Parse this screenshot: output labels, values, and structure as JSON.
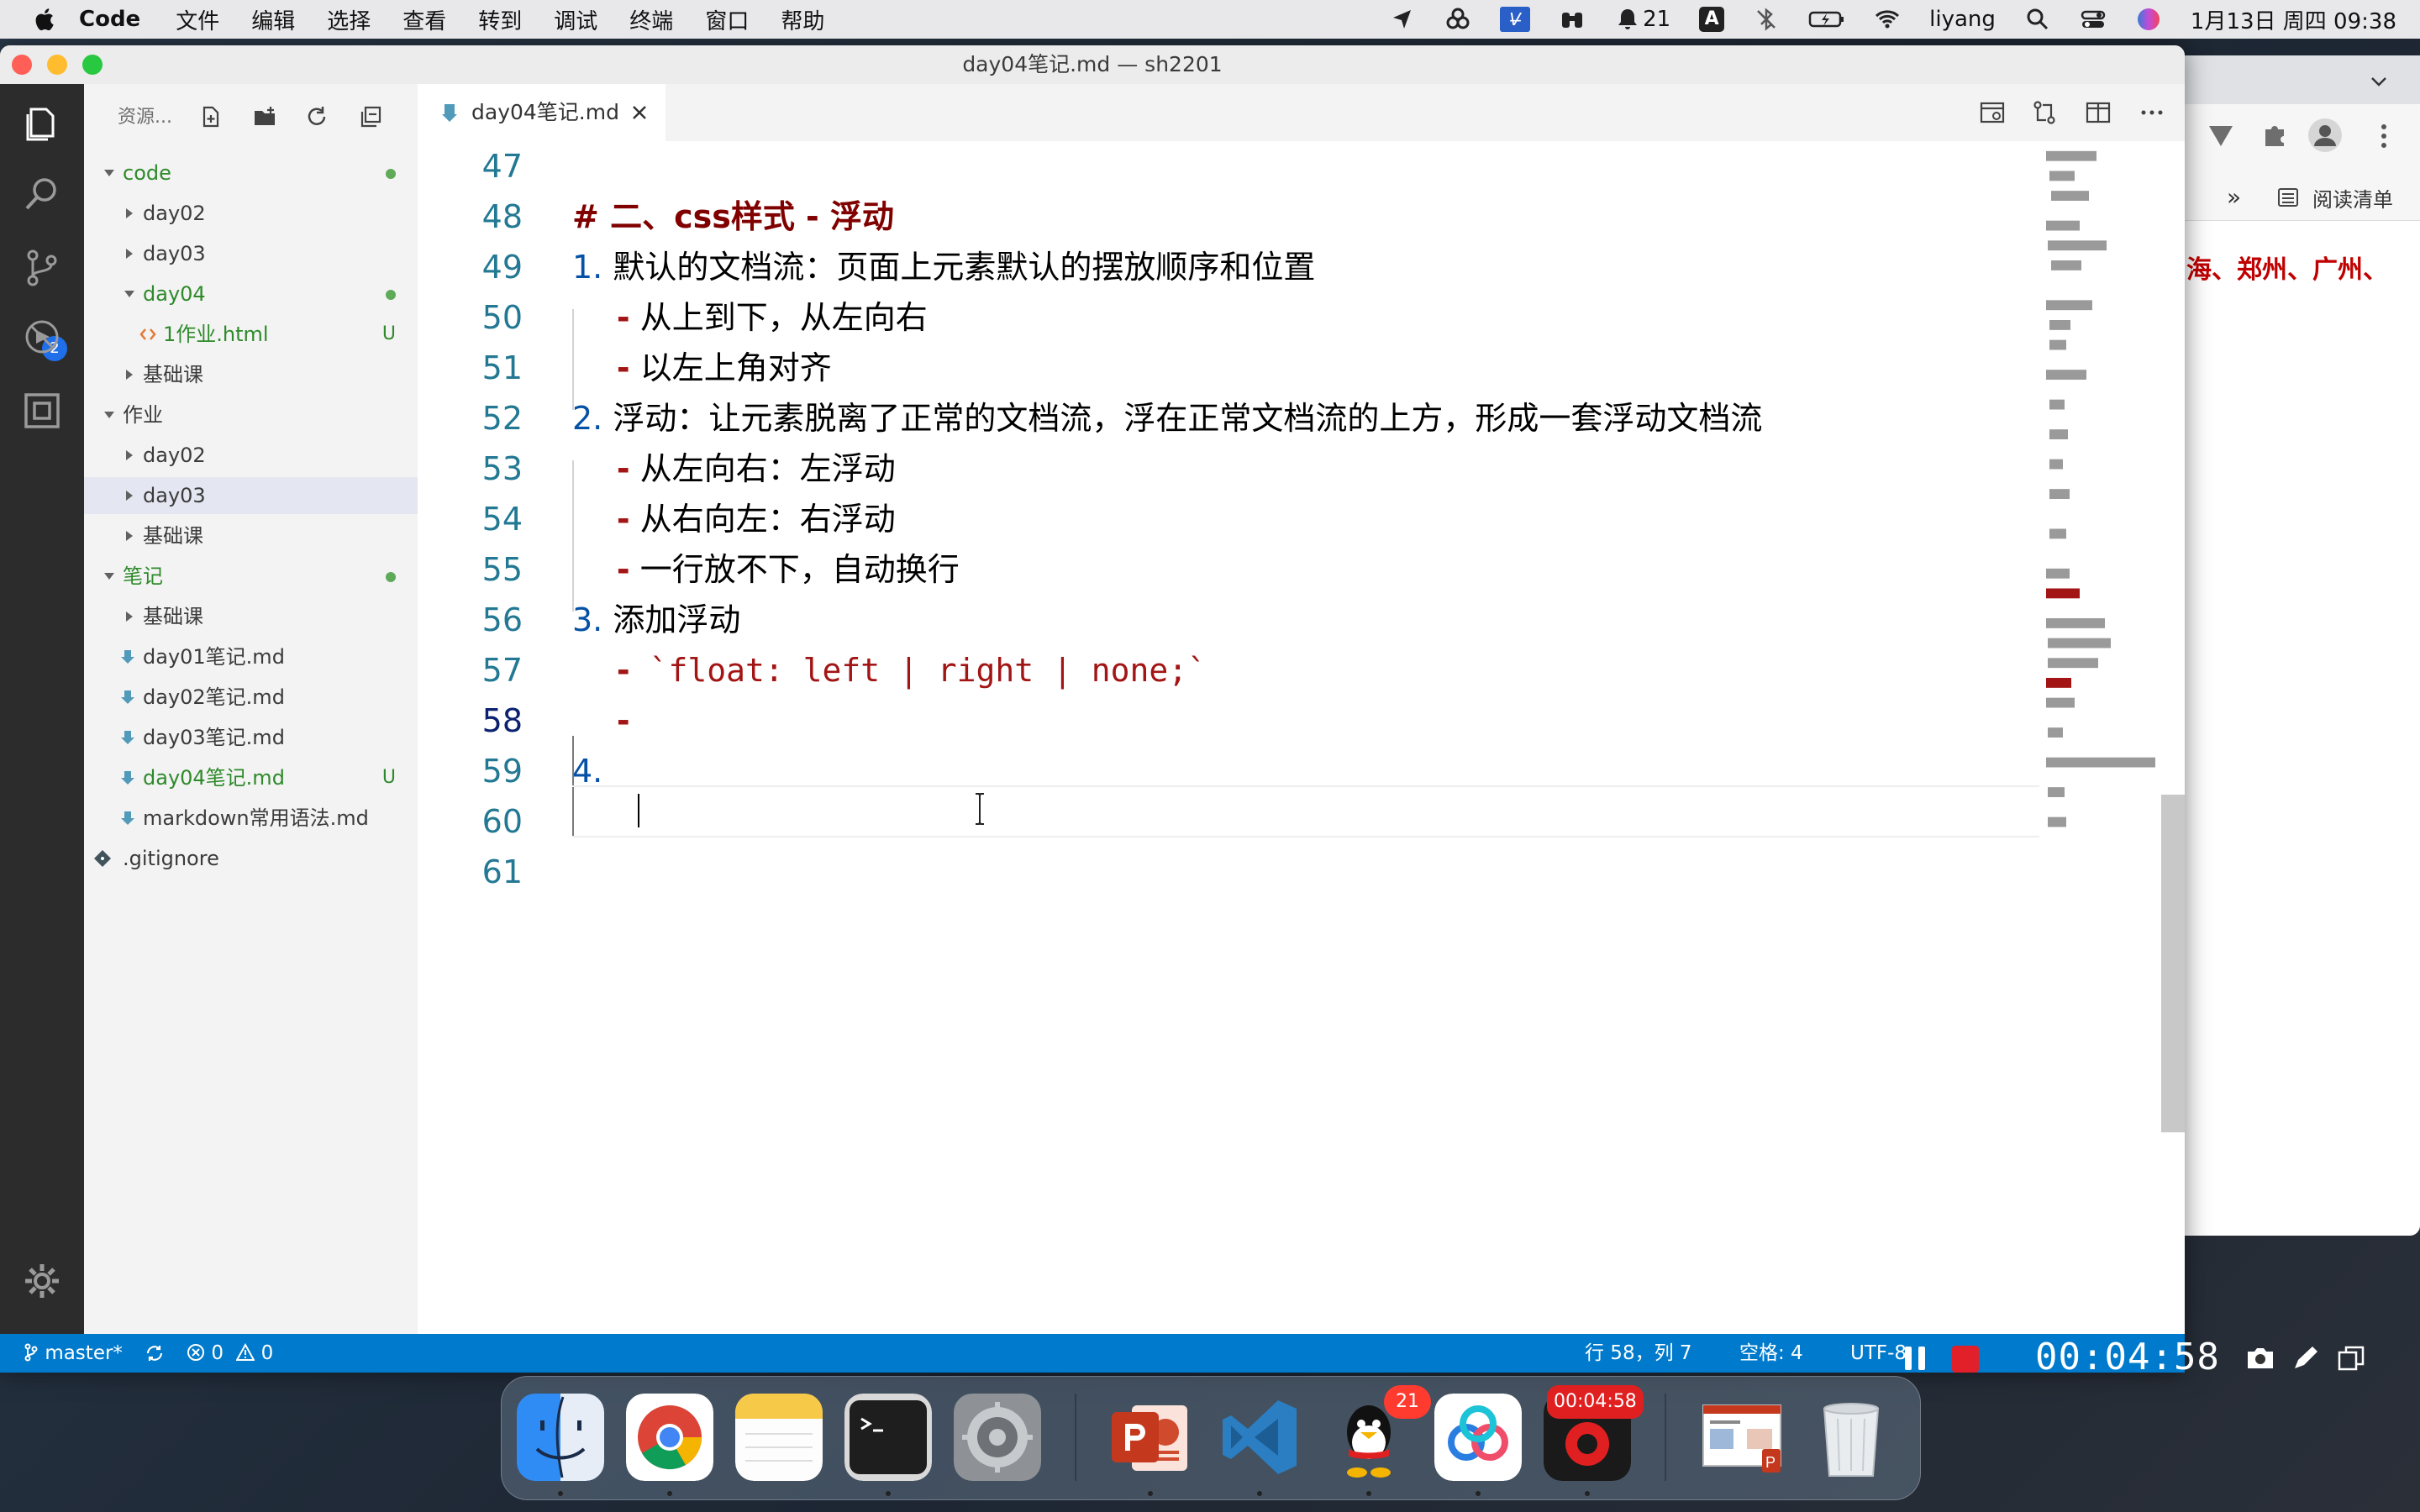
{
  "menubar": {
    "app_name": "Code",
    "items": [
      "文件",
      "编辑",
      "选择",
      "查看",
      "转到",
      "调试",
      "终端",
      "窗口",
      "帮助"
    ],
    "notification_count": "21",
    "input_method": "A",
    "user": "liyang",
    "datetime": "1月13日 周四  09:38",
    "vs_badge": "V̶"
  },
  "window": {
    "title": "day04笔记.md — sh2201"
  },
  "activity_bar": {
    "scm_badge": "2"
  },
  "sidebar": {
    "title": "资源...",
    "tree": [
      {
        "label": "code",
        "kind": "folder-open",
        "level": 0,
        "dot": true,
        "color": "green"
      },
      {
        "label": "day02",
        "kind": "folder",
        "level": 1
      },
      {
        "label": "day03",
        "kind": "folder",
        "level": 1
      },
      {
        "label": "day04",
        "kind": "folder-open",
        "level": 1,
        "dot": true,
        "color": "green"
      },
      {
        "label": "1作业.html",
        "kind": "html",
        "level": 2,
        "status": "U",
        "color": "green"
      },
      {
        "label": "基础课",
        "kind": "folder",
        "level": 1
      },
      {
        "label": "作业",
        "kind": "folder-open",
        "level": 0
      },
      {
        "label": "day02",
        "kind": "folder",
        "level": 1
      },
      {
        "label": "day03",
        "kind": "folder",
        "level": 1,
        "selected": true
      },
      {
        "label": "基础课",
        "kind": "folder",
        "level": 1
      },
      {
        "label": "笔记",
        "kind": "folder-open",
        "level": 0,
        "dot": true,
        "color": "green"
      },
      {
        "label": "基础课",
        "kind": "folder",
        "level": 1
      },
      {
        "label": "day01笔记.md",
        "kind": "md",
        "level": 1
      },
      {
        "label": "day02笔记.md",
        "kind": "md",
        "level": 1
      },
      {
        "label": "day03笔记.md",
        "kind": "md",
        "level": 1
      },
      {
        "label": "day04笔记.md",
        "kind": "md",
        "level": 1,
        "status": "U",
        "color": "green"
      },
      {
        "label": "markdown常用语法.md",
        "kind": "md",
        "level": 1
      },
      {
        "label": ".gitignore",
        "kind": "git",
        "level": 0
      }
    ]
  },
  "editor": {
    "tab_label": "day04笔记.md",
    "lines": [
      {
        "n": "47",
        "parts": []
      },
      {
        "n": "48",
        "parts": [
          {
            "t": "# 二、css样式 - 浮动",
            "c": "heading"
          }
        ]
      },
      {
        "n": "49",
        "parts": [
          {
            "t": "1.",
            "c": "num"
          },
          {
            "t": " 默认的文档流：页面上元素默认的摆放顺序和位置",
            "c": "plain"
          }
        ]
      },
      {
        "n": "50",
        "parts": [
          {
            "t": "    -",
            "c": "dash"
          },
          {
            "t": " 从上到下，从左向右",
            "c": "plain"
          }
        ]
      },
      {
        "n": "51",
        "parts": [
          {
            "t": "    -",
            "c": "dash"
          },
          {
            "t": " 以左上角对齐",
            "c": "plain"
          }
        ]
      },
      {
        "n": "52",
        "parts": [
          {
            "t": "2.",
            "c": "num"
          },
          {
            "t": " 浮动：让元素脱离了正常的文档流，浮在正常文档流的上方，形成一套浮动文档流",
            "c": "plain"
          }
        ]
      },
      {
        "n": "53",
        "parts": [
          {
            "t": "    -",
            "c": "dash"
          },
          {
            "t": " 从左向右：左浮动",
            "c": "plain"
          }
        ]
      },
      {
        "n": "54",
        "parts": [
          {
            "t": "    -",
            "c": "dash"
          },
          {
            "t": " 从右向左：右浮动",
            "c": "plain"
          }
        ]
      },
      {
        "n": "55",
        "parts": [
          {
            "t": "    -",
            "c": "dash"
          },
          {
            "t": " 一行放不下，自动换行",
            "c": "plain"
          }
        ]
      },
      {
        "n": "56",
        "parts": [
          {
            "t": "3.",
            "c": "num"
          },
          {
            "t": " 添加浮动",
            "c": "plain"
          }
        ]
      },
      {
        "n": "57",
        "parts": [
          {
            "t": "    -",
            "c": "dash"
          },
          {
            "t": " `float: left | right | none;`",
            "c": "code"
          }
        ]
      },
      {
        "n": "58",
        "parts": [
          {
            "t": "    -",
            "c": "dash"
          }
        ],
        "active": true
      },
      {
        "n": "59",
        "parts": [
          {
            "t": "4.",
            "c": "num"
          }
        ]
      },
      {
        "n": "60",
        "parts": []
      },
      {
        "n": "61",
        "parts": []
      }
    ]
  },
  "statusbar": {
    "branch": "master*",
    "errors": "0",
    "warnings": "0",
    "position": "行 58，列 7",
    "spaces": "空格: 4",
    "encoding": "UTF-8"
  },
  "recorder": {
    "elapsed": "00:04:58"
  },
  "dock": {
    "recording_badge": "00:04:58",
    "qq_badge": "21"
  },
  "browser": {
    "bookmark_label": "阅读清单",
    "overflow": "»",
    "content_text": "海、郑州、广州、"
  }
}
